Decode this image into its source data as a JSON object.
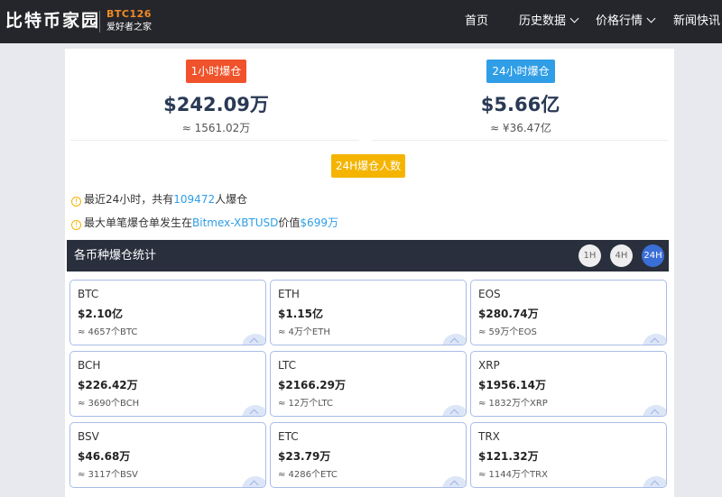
{
  "header": {
    "logo": "比特币家园",
    "logo_code": "BTC126",
    "logo_slogan": "爱好者之家",
    "nav": [
      {
        "label": "首页",
        "dropdown": false
      },
      {
        "label": "历史数据",
        "dropdown": true
      },
      {
        "label": "价格行情",
        "dropdown": true
      },
      {
        "label": "新闻快讯",
        "dropdown": false
      }
    ]
  },
  "summary": {
    "h1": {
      "badge": "1小时爆仓",
      "amount": "$242.09万",
      "approx": "≈ 1561.02万"
    },
    "h24": {
      "badge": "24小时爆仓",
      "amount": "$5.66亿",
      "approx": "≈ ¥36.47亿"
    },
    "count_badge": "24H爆仓人数"
  },
  "info": {
    "line1": {
      "prefix": "最近24小时，共有",
      "count": "109472",
      "suffix": "人爆仓"
    },
    "line2": {
      "prefix": "最大单笔爆仓单发生在",
      "exchange": "Bitmex-XBTUSD",
      "middle": "价值",
      "value": "$699万"
    }
  },
  "section": {
    "title": "各币种爆仓统计",
    "timeframes": [
      "1H",
      "4H",
      "24H"
    ],
    "active_timeframe": "24H"
  },
  "coins": [
    {
      "symbol": "BTC",
      "value": "$2.10亿",
      "qty": "≈ 4657个BTC"
    },
    {
      "symbol": "ETH",
      "value": "$1.15亿",
      "qty": "≈ 4万个ETH"
    },
    {
      "symbol": "EOS",
      "value": "$280.74万",
      "qty": "≈ 59万个EOS"
    },
    {
      "symbol": "BCH",
      "value": "$226.42万",
      "qty": "≈ 3690个BCH"
    },
    {
      "symbol": "LTC",
      "value": "$2166.29万",
      "qty": "≈ 12万个LTC"
    },
    {
      "symbol": "XRP",
      "value": "$1956.14万",
      "qty": "≈ 1832万个XRP"
    },
    {
      "symbol": "BSV",
      "value": "$46.68万",
      "qty": "≈ 3117个BSV"
    },
    {
      "symbol": "ETC",
      "value": "$23.79万",
      "qty": "≈ 4286个ETC"
    },
    {
      "symbol": "TRX",
      "value": "$121.32万",
      "qty": "≈ 1144万个TRX"
    }
  ],
  "colors": {
    "topbar": "#25262b",
    "accent_orange": "#f0522b",
    "accent_blue": "#2f9ee6",
    "accent_yellow": "#f4b400",
    "active_timeframe": "#3a6fd8",
    "amount_text": "#2a3a55"
  },
  "icons": {
    "info_bullet": "warning-circle-icon",
    "nav_dropdown": "chevron-down-icon",
    "card_corner": "chevron-up-icon"
  }
}
